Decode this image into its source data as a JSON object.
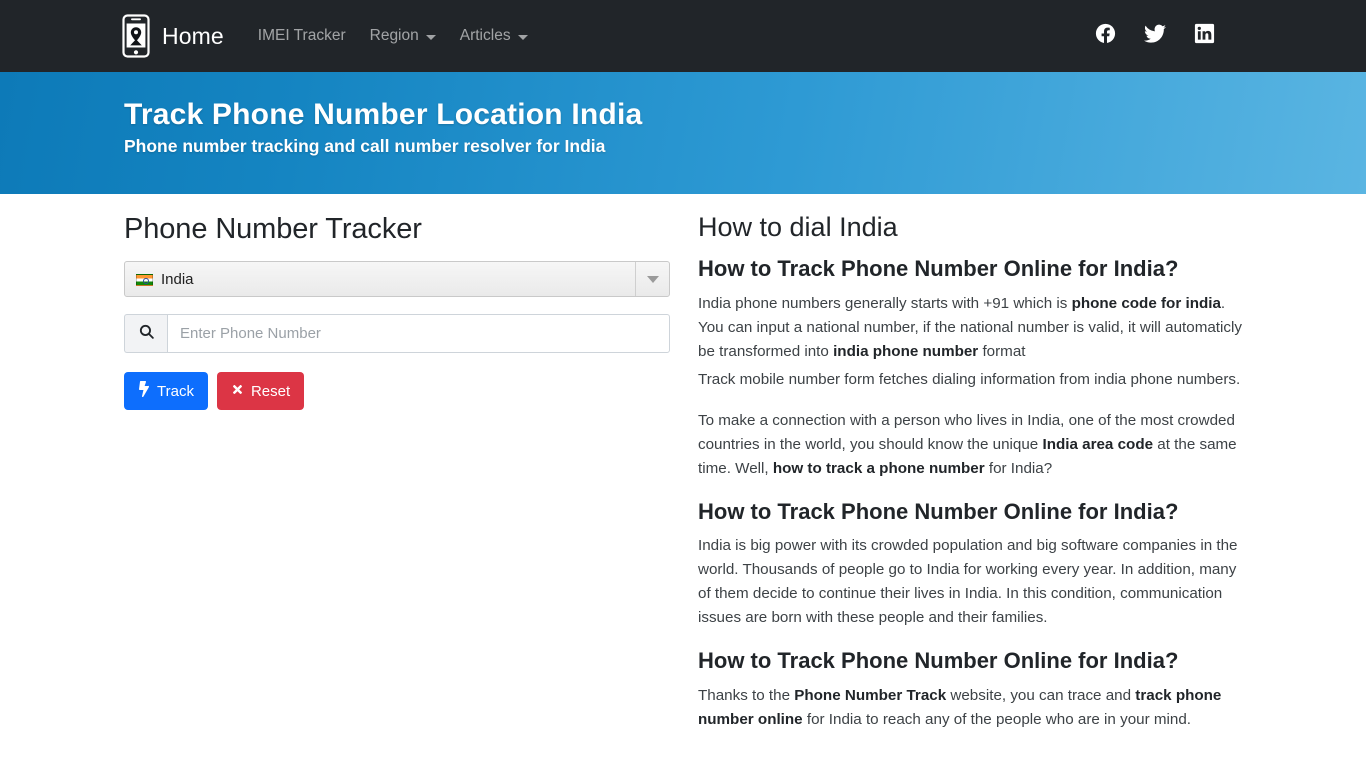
{
  "navbar": {
    "logo_icon": "phone-location-pin-icon",
    "brand": "Home",
    "links": [
      {
        "label": "IMEI Tracker",
        "has_caret": false
      },
      {
        "label": "Region",
        "has_caret": true
      },
      {
        "label": "Articles",
        "has_caret": true
      }
    ],
    "social": [
      {
        "name": "facebook-icon",
        "label": "Facebook"
      },
      {
        "name": "twitter-icon",
        "label": "Twitter"
      },
      {
        "name": "linkedin-icon",
        "label": "LinkedIn"
      }
    ]
  },
  "hero": {
    "title": "Track Phone Number Location India",
    "subtitle": "Phone number tracking and call number resolver for India",
    "gradient_from": "#0d7ab8",
    "gradient_to": "#5ab5e2"
  },
  "form": {
    "title": "Phone Number Tracker",
    "country": {
      "selected": "India",
      "flag": "india-flag-icon"
    },
    "phone": {
      "value": "",
      "placeholder": "Enter Phone Number",
      "icon": "search-icon"
    },
    "buttons": {
      "track": {
        "label": "Track",
        "icon": "bolt-icon",
        "color": "#0d6efd"
      },
      "reset": {
        "label": "Reset",
        "icon": "times-icon",
        "color": "#dc3545"
      }
    }
  },
  "article": {
    "heading": "How to dial India",
    "sections": [
      {
        "title": "How to Track Phone Number Online for India?",
        "paragraphs": [
          {
            "parts": [
              {
                "text": "India phone numbers generally starts with +91 which is ",
                "bold": false
              },
              {
                "text": "phone code for india",
                "bold": true
              },
              {
                "text": ". You can input a national number, if the national number is valid, it will automaticly be transformed into ",
                "bold": false
              },
              {
                "text": "india phone number",
                "bold": true
              },
              {
                "text": " format",
                "bold": false
              }
            ]
          },
          {
            "parts": [
              {
                "text": "Track mobile number form fetches dialing information from india phone numbers.",
                "bold": false
              }
            ]
          },
          {
            "parts": [
              {
                "text": "To make a connection with a person who lives in India, one of the most crowded countries in the world, you should know the unique ",
                "bold": false
              },
              {
                "text": "India area code",
                "bold": true
              },
              {
                "text": " at the same time. Well, ",
                "bold": false
              },
              {
                "text": "how to track a phone number",
                "bold": true
              },
              {
                "text": " for India?",
                "bold": false
              }
            ]
          }
        ]
      },
      {
        "title": "How to Track Phone Number Online for India?",
        "paragraphs": [
          {
            "parts": [
              {
                "text": "India is big power with its crowded population and big software companies in the world. Thousands of people go to India for working every year. In addition, many of them decide to continue their lives in India. In this condition, communication issues are born with these people and their families.",
                "bold": false
              }
            ]
          }
        ]
      },
      {
        "title": "How to Track Phone Number Online for India?",
        "paragraphs": [
          {
            "parts": [
              {
                "text": "Thanks to the ",
                "bold": false
              },
              {
                "text": "Phone Number Track",
                "bold": true
              },
              {
                "text": " website, you can trace and ",
                "bold": false
              },
              {
                "text": "track phone number online",
                "bold": true
              },
              {
                "text": " for India to reach any of the people who are in your mind.",
                "bold": false
              }
            ]
          }
        ]
      }
    ]
  }
}
